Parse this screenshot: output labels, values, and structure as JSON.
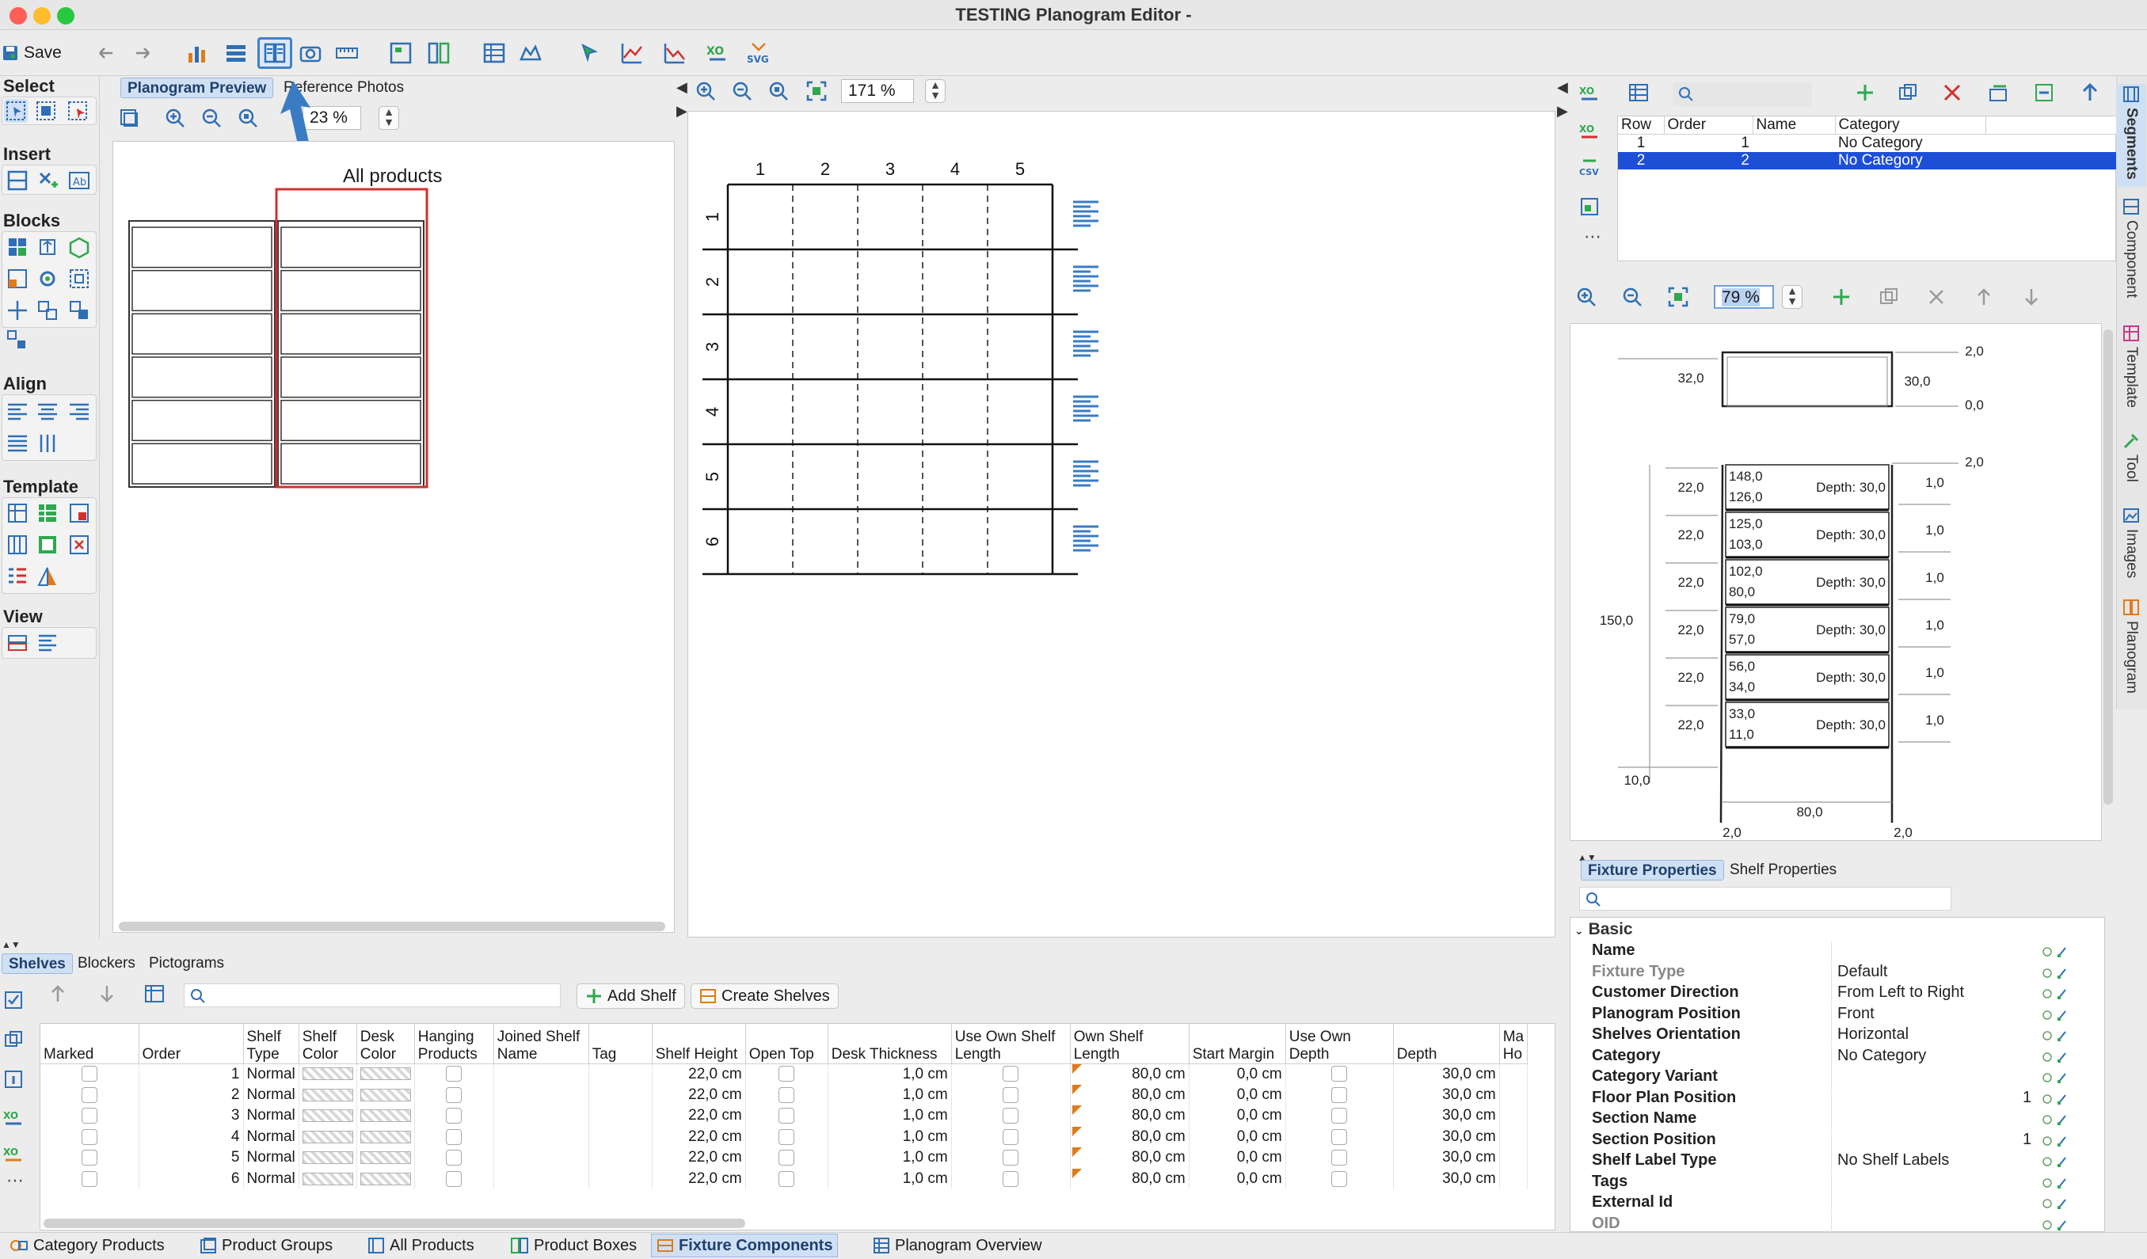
{
  "window": {
    "title": "TESTING Planogram Editor -"
  },
  "toolbar": {
    "save_label": "Save"
  },
  "palette": {
    "select": "Select",
    "insert": "Insert",
    "blocks": "Blocks",
    "align": "Align",
    "template": "Template",
    "view": "View"
  },
  "preview": {
    "tabs": [
      "Planogram Preview",
      "Reference Photos"
    ],
    "zoom": "23 %",
    "label": "All products"
  },
  "main": {
    "zoom": "171 %",
    "cols": [
      "1",
      "2",
      "3",
      "4",
      "5"
    ],
    "rows": [
      "1",
      "2",
      "3",
      "4",
      "5",
      "6"
    ]
  },
  "segments": {
    "search_placeholder": "",
    "headers": [
      "Row",
      "Order",
      "Name",
      "Category"
    ],
    "rows": [
      {
        "row": "1",
        "order": "1",
        "name": "",
        "category": "No Category"
      },
      {
        "row": "2",
        "order": "2",
        "name": "",
        "category": "No Category"
      }
    ]
  },
  "fixture_view": {
    "zoom": "79 %",
    "dims": {
      "top_right": "2,0",
      "top_left": "32,0",
      "top_mid": "30,0",
      "top_zero": "0,0",
      "right_top2": "2,0",
      "total_height": "150,0",
      "bottom_left": "10,0",
      "width": "80,0",
      "bl": "2,0",
      "br": "2,0"
    },
    "shelves": [
      {
        "top": "148,0",
        "bottom": "126,0",
        "depth": "Depth: 30,0",
        "height": "22,0",
        "thick": "1,0"
      },
      {
        "top": "125,0",
        "bottom": "103,0",
        "depth": "Depth: 30,0",
        "height": "22,0",
        "thick": "1,0"
      },
      {
        "top": "102,0",
        "bottom": "80,0",
        "depth": "Depth: 30,0",
        "height": "22,0",
        "thick": "1,0"
      },
      {
        "top": "79,0",
        "bottom": "57,0",
        "depth": "Depth: 30,0",
        "height": "22,0",
        "thick": "1,0"
      },
      {
        "top": "56,0",
        "bottom": "34,0",
        "depth": "Depth: 30,0",
        "height": "22,0",
        "thick": "1,0"
      },
      {
        "top": "33,0",
        "bottom": "11,0",
        "depth": "Depth: 30,0",
        "height": "22,0",
        "thick": "1,0"
      }
    ]
  },
  "side_tabs": [
    "Segments",
    "Component",
    "Template",
    "Tool",
    "Images",
    "Planogram"
  ],
  "properties": {
    "tabs": [
      "Fixture Properties",
      "Shelf Properties"
    ],
    "section": "Basic",
    "rows": [
      {
        "key": "Name",
        "value": "",
        "dim": false
      },
      {
        "key": "Fixture Type",
        "value": "Default",
        "dim": true
      },
      {
        "key": "Customer Direction",
        "value": "From Left to Right",
        "dim": false
      },
      {
        "key": "Planogram Position",
        "value": "Front",
        "dim": false
      },
      {
        "key": "Shelves Orientation",
        "value": "Horizontal",
        "dim": false
      },
      {
        "key": "Category",
        "value": "No Category",
        "dim": false
      },
      {
        "key": "Category Variant",
        "value": "",
        "dim": false
      },
      {
        "key": "Floor Plan Position",
        "value": "1",
        "dim": false
      },
      {
        "key": "Section Name",
        "value": "",
        "dim": false
      },
      {
        "key": "Section Position",
        "value": "1",
        "dim": false
      },
      {
        "key": "Shelf Label Type",
        "value": "No Shelf Labels",
        "dim": false
      },
      {
        "key": "Tags",
        "value": "",
        "dim": false
      },
      {
        "key": "External Id",
        "value": "",
        "dim": false
      },
      {
        "key": "OID",
        "value": "",
        "dim": true
      }
    ]
  },
  "shelves_panel": {
    "tabs": [
      "Shelves",
      "Blockers",
      "Pictograms"
    ],
    "add_shelf": "Add Shelf",
    "create_shelves": "Create Shelves",
    "headers": [
      "Marked",
      "Order",
      "Shelf Type",
      "Shelf Color",
      "Desk Color",
      "Hanging Products",
      "Joined Shelf Name",
      "Tag",
      "Shelf Height",
      "Open Top",
      "Desk Thickness",
      "Use Own Shelf Length",
      "Own Shelf Length",
      "Start Margin",
      "Use Own Depth",
      "Depth",
      "Ma Ho"
    ],
    "rows": [
      {
        "order": "1",
        "type": "Normal",
        "height": "22,0 cm",
        "thick": "1,0 cm",
        "length": "80,0 cm",
        "margin": "0,0 cm",
        "depth": "30,0 cm"
      },
      {
        "order": "2",
        "type": "Normal",
        "height": "22,0 cm",
        "thick": "1,0 cm",
        "length": "80,0 cm",
        "margin": "0,0 cm",
        "depth": "30,0 cm"
      },
      {
        "order": "3",
        "type": "Normal",
        "height": "22,0 cm",
        "thick": "1,0 cm",
        "length": "80,0 cm",
        "margin": "0,0 cm",
        "depth": "30,0 cm"
      },
      {
        "order": "4",
        "type": "Normal",
        "height": "22,0 cm",
        "thick": "1,0 cm",
        "length": "80,0 cm",
        "margin": "0,0 cm",
        "depth": "30,0 cm"
      },
      {
        "order": "5",
        "type": "Normal",
        "height": "22,0 cm",
        "thick": "1,0 cm",
        "length": "80,0 cm",
        "margin": "0,0 cm",
        "depth": "30,0 cm"
      },
      {
        "order": "6",
        "type": "Normal",
        "height": "22,0 cm",
        "thick": "1,0 cm",
        "length": "80,0 cm",
        "margin": "0,0 cm",
        "depth": "30,0 cm"
      }
    ]
  },
  "bottom_tabs": [
    "Category Products",
    "Product Groups",
    "All Products",
    "Product Boxes",
    "Fixture Components",
    "Planogram Overview"
  ],
  "colors": {
    "accent": "#2f6fb5",
    "selection": "#1d4fd6",
    "frame_red": "#d0312d"
  }
}
